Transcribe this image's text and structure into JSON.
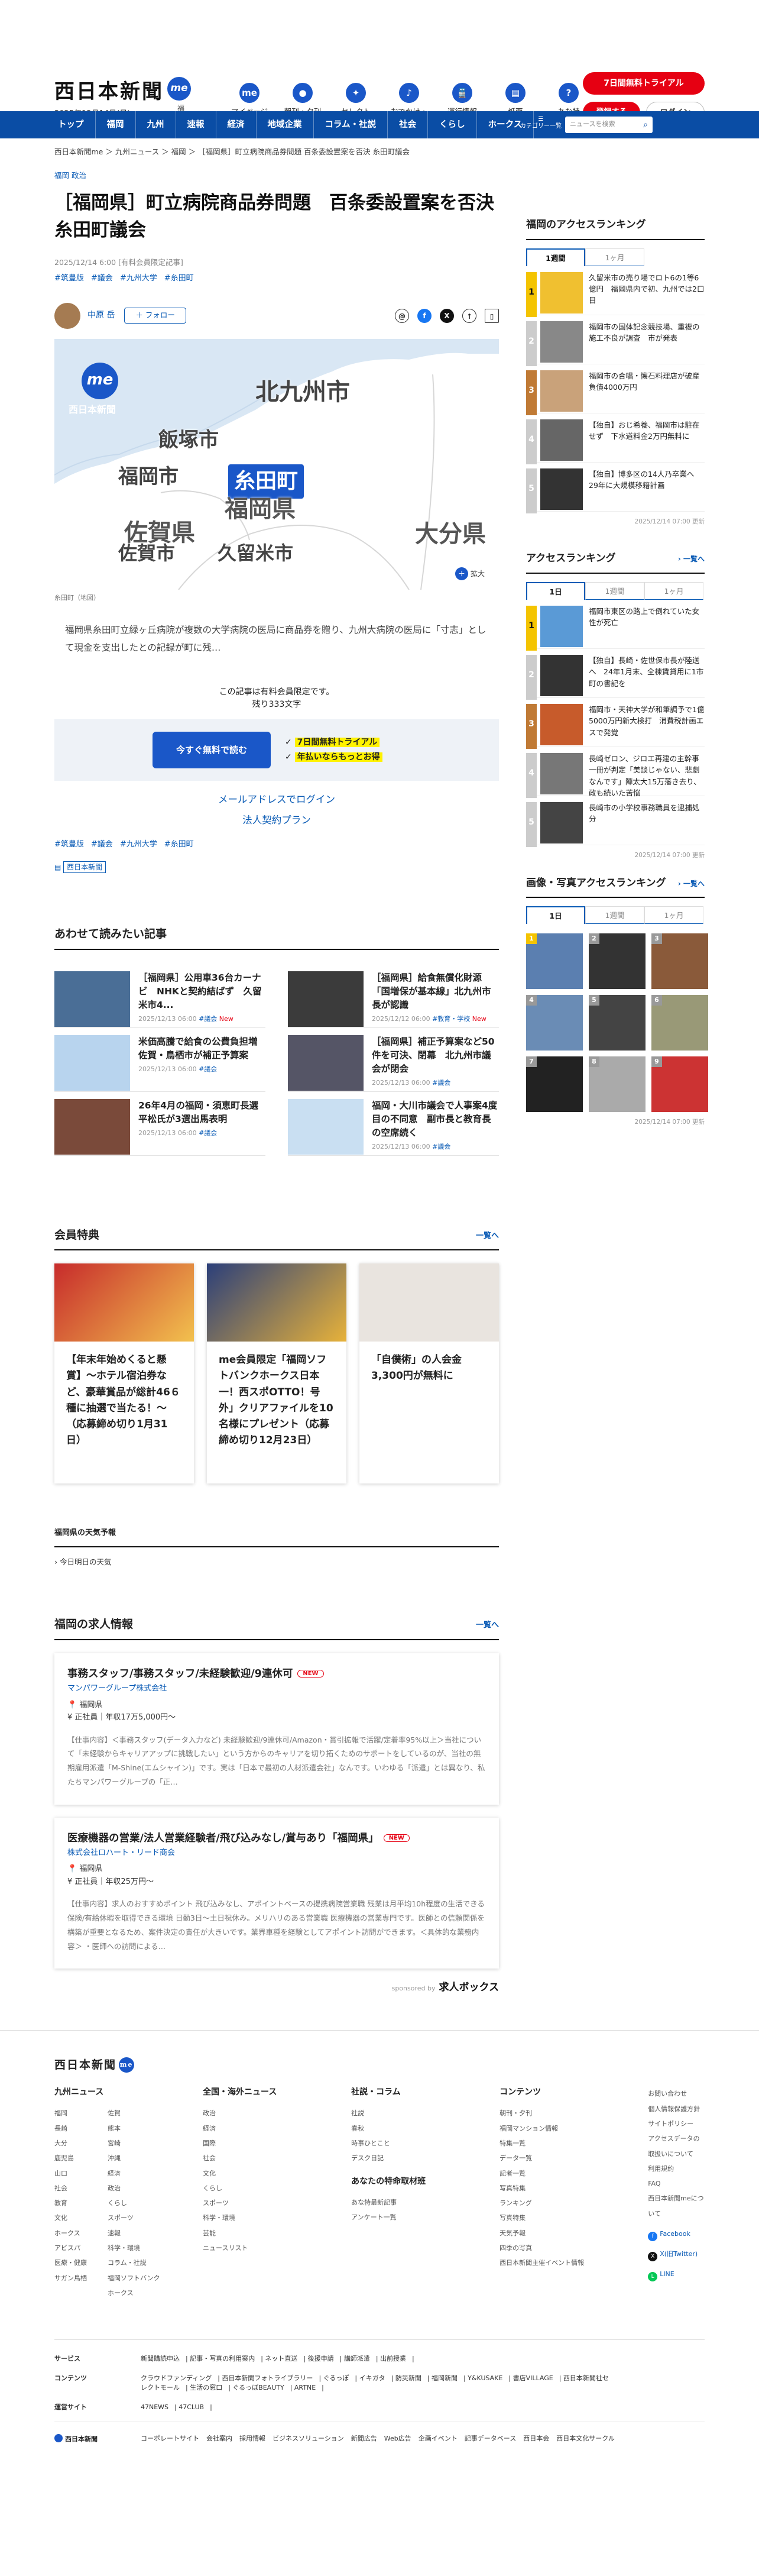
{
  "header": {
    "logo": "西日本新聞",
    "logo_mark": "me",
    "date": "2025年12月14日(日)",
    "corner": "福岡",
    "icons": [
      {
        "label": "マイページ",
        "icon": "me"
      },
      {
        "label": "朝刊・夕刊",
        "icon": "●"
      },
      {
        "label": "セレクト",
        "icon": "✦"
      },
      {
        "label": "おでかけ・特典",
        "icon": "♪"
      },
      {
        "label": "運行情報",
        "icon": "🚆"
      },
      {
        "label": "紙面",
        "icon": "▤"
      },
      {
        "label": "あな特",
        "icon": "?"
      }
    ],
    "trial": "7日間無料トライアル",
    "register": "登録する",
    "login": "ログイン"
  },
  "nav": {
    "items": [
      "トップ",
      "福岡",
      "九州",
      "速報",
      "経済",
      "地域企業",
      "コラム・社説",
      "社会",
      "くらし",
      "ホークス"
    ],
    "category": "カテゴリー一覧",
    "search_placeholder": "ニュースを検索"
  },
  "breadcrumb": "西日本新聞me ＞ 九州ニュース ＞ 福岡 ＞ ［福岡県］町立病院商品券問題 百条委設置案を否決 糸田町議会",
  "article": {
    "tags": "福岡 政治",
    "title": "［福岡県］町立病院商品券問題　百条委設置案を否決　糸田町議会",
    "date": "2025/12/14 6:00 [有料会員限定記事]",
    "keywords": [
      "#筑豊版",
      "#議会",
      "#九州大学",
      "#糸田町"
    ],
    "author": "中原 岳",
    "follow": "＋ フォロー",
    "map": {
      "labels": [
        "北九州市",
        "飯塚市",
        "福岡市",
        "糸田町",
        "福岡県",
        "佐賀県",
        "佐賀市",
        "久留米市",
        "大分県"
      ],
      "me": "me",
      "brand": "西日本新聞",
      "zoom": "拡大",
      "caption": "糸田町（地図）"
    },
    "lead": "福岡県糸田町立緑ヶ丘病院が複数の大学病院の医局に商品券を贈り、九州大病院の医局に「寸志」として現金を支出したとの記録が町に残…",
    "member_note": "この記事は有料会員限定です。",
    "remain": "残り333文字",
    "cta": "今すぐ無料で読む",
    "benefits": [
      "7日間無料トライアル",
      "年払いならもっとお得"
    ],
    "login_link": "メールアドレスでログイン",
    "plan_link": "法人契約プラン",
    "source": "西日本新聞"
  },
  "related": {
    "title": "あわせて読みたい記事",
    "items": [
      {
        "title": "［福岡県］公用車36台カーナビ　NHKと契約結ばず　久留米市4...",
        "meta": "2025/12/13 06:00",
        "tag": "議会",
        "new": "New"
      },
      {
        "title": "［福岡県］給食無償化財源「国増保が基本線」北九州市長が認識",
        "meta": "2025/12/12 06:00",
        "tag": "教育・学校",
        "new": "New"
      },
      {
        "title": "米価高騰で給食の公費負担増　佐賀・鳥栖市が補正予算案",
        "meta": "2025/12/13 06:00",
        "tag": "議会",
        "new": ""
      },
      {
        "title": "［福岡県］補正予算案など50件を可決、閉幕　北九州市議会が閉会",
        "meta": "2025/12/13 06:00",
        "tag": "議会",
        "new": ""
      },
      {
        "title": "26年4月の福岡・須恵町長選　平松氏が3選出馬表明",
        "meta": "2025/12/13 06:00",
        "tag": "議会",
        "new": ""
      },
      {
        "title": "福岡・大川市議会で人事案4度目の不同意　副市長と教育長の空席続く",
        "meta": "2025/12/13 06:00",
        "tag": "議会",
        "new": ""
      }
    ]
  },
  "perks": {
    "title": "会員特典",
    "more": "一覧へ",
    "items": [
      "【年末年始めくると懸賞】〜ホテル宿泊券など、豪華賞品が総計46６種に抽選で当たる！〜（応募締め切り1月31日）",
      "me会員限定「福岡ソフトバンクホークス日本一！西スポOTTO！号外」クリアファイルを10名様にプレゼント（応募締め切り12月23日）",
      "「自僕術」の人会金3,300円が無料に"
    ]
  },
  "weather": {
    "title": "福岡県の天気予報",
    "sub": "今日明日の天気"
  },
  "jobs": {
    "title": "福岡の求人情報",
    "more": "一覧へ",
    "items": [
      {
        "title": "事務スタッフ/事務スタッフ/未経験歓迎/9連休可",
        "new": "NEW",
        "company": "マンパワーグループ株式会社",
        "place": "福岡県",
        "pay": "正社員｜年収17万5,000円〜",
        "text": "【仕事内容】＜事務スタッフ(データ入力など) 未経験歓迎/9連休可/Amazon・賞引拡報で活躍/定着率95%以上＞当社について「未経験からキャリアアップに挑戦したい」という方からのキャリアを切り拓くためのサポートをしているのが、当社の無期雇用派遣「M-Shine(エムシャイン)」です。実は「日本で最初の人材派遣会社」なんです。いわゆる「派遣」とは異なり、私たちマンパワーグループの「正…"
      },
      {
        "title": "医療機器の営業/法人営業経験者/飛び込みなし/賞与あり「福岡県」",
        "new": "NEW",
        "company": "株式会社ロハート・リード商会",
        "place": "福岡県",
        "pay": "正社員｜年収25万円〜",
        "text": "【仕事内容】求人のおすすめポイント 飛び込みなし、アポイントベースの提携病院営業職 残業は月平均10h程度の生活できる保険/有給休暇を取得できる環境 日勤3日〜土日祝休み。メリハリのある営業職 医療機器の営業専門です。医師との信頼関係を構築が重要となるため、案件決定の責任が大きいです。業界車種を経験としてアポイント訪問ができます。＜具体的な業務内容＞ ・医師への訪問による…"
      }
    ],
    "sponsor": "sponsored by",
    "sponsor_name": "求人ボックス"
  },
  "sidebar": {
    "access": {
      "title": "福岡のアクセスランキング",
      "tabs": [
        "1週間",
        "1ヶ月"
      ],
      "items": [
        "久留米市の売り場でロト6の1等6億円　福岡県内で初、九州では2口目",
        "福岡市の国体記念競技場、重複の施工不良が調査　市が発表",
        "福岡市の合唱・懐石料理店が破産　負債4000万円",
        "【独自】おじ希養、福岡市は駐在せず　下水道料金2万円無料に",
        "【独自】博多区の14人乃卒業へ　29年に大規模移籍計画"
      ],
      "updated": "2025/12/14 07:00 更新"
    },
    "all": {
      "title": "アクセスランキング",
      "more": "一覧へ",
      "tabs": [
        "1日",
        "1週間",
        "1ヶ月"
      ],
      "items": [
        "福岡市東区の路上で倒れていた女性が死亡",
        "【独自】長崎・佐世保市長が陸送へ　24年1月末、全棟賃貸用に1市町の書記を",
        "福岡市・天神大学が和筆調予で1億5000万円新大検打　消費税計画エスで発覚",
        "長崎ゼロン、ジロエ再建の主幹事一冊が判定「美談じゃない、悲劇なんです」陣太大15万藩き去り、政も続いた苦悩",
        "長崎市の小学校事務職員を逮捕処分"
      ],
      "updated": "2025/12/14 07:00 更新"
    },
    "photo": {
      "title": "画像・写真アクセスランキング",
      "more": "一覧へ",
      "tabs": [
        "1日",
        "1週間",
        "1ヶ月"
      ],
      "updated": "2025/12/14 07:00 更新"
    }
  },
  "footer": {
    "logo": "西日本新聞",
    "cols": [
      {
        "title": "九州ニュース",
        "links": [
          "福岡",
          "佐賀",
          "長崎",
          "熊本",
          "大分",
          "宮崎",
          "鹿児島",
          "沖縄",
          "山口",
          "経済",
          "社会",
          "政治",
          "教育",
          "くらし",
          "文化",
          "スポーツ",
          "ホークス",
          "速報",
          "アビスパ",
          "科学・環境",
          "医療・健康",
          "コラム・社説",
          "サガン鳥栖",
          "福岡ソフトバンクホークス"
        ]
      },
      {
        "title": "全国・海外ニュース",
        "links": [
          "政治",
          "経済",
          "国際",
          "社会",
          "文化",
          "くらし",
          "スポーツ",
          "科学・環境",
          "芸能",
          "ニュースリスト"
        ]
      },
      {
        "title": "社説・コラム",
        "links": [
          "社説",
          "春秋",
          "時事ひとこと",
          "デスク日記"
        ],
        "sub": "あなたの特命取材班",
        "sublinks": [
          "あな特最新記事",
          "アンケート一覧"
        ]
      },
      {
        "title": "コンテンツ",
        "links": [
          "朝刊・夕刊",
          "福岡マンション情報",
          "特集一覧",
          "データ一覧",
          "記者一覧",
          "写真特集",
          "ランキング",
          "写真特集",
          "天気予報",
          "四季の写真",
          "西日本新聞主催イベント情報"
        ]
      },
      {
        "title": "",
        "links": [
          "お問い合わせ",
          "個人情報保護方針",
          "サイトポリシー",
          "アクセスデータの取扱いについて",
          "利用規約",
          "FAQ",
          "西日本新聞meについて"
        ],
        "sns": [
          "Facebook",
          "X(旧Twitter)",
          "LINE"
        ]
      }
    ],
    "rows": [
      {
        "label": "サービス",
        "links": [
          "新聞購読申込",
          "記事・写真の利用案内",
          "ネット直送",
          "後援申請",
          "講師派遣",
          "出前授業"
        ]
      },
      {
        "label": "コンテンツ",
        "links": [
          "クラウドファンディング",
          "西日本新聞フォトライブラリー",
          "ぐるっぽ",
          "イキガタ",
          "防災新聞",
          "福岡新聞",
          "Y&KUSAKE",
          "書店VILLAGE",
          "西日本新聞社セレクトモール",
          "生活の窓口",
          "ぐるっぽBEAUTY",
          "ARTNE"
        ]
      },
      {
        "label": "運営サイト",
        "links": [
          "47NEWS",
          "47CLUB"
        ]
      }
    ],
    "bottom_logo": "西日本新聞",
    "bottom_links": [
      "コーポレートサイト",
      "会社案内",
      "採用情報",
      "ビジネスソリューション",
      "新聞広告",
      "Web広告",
      "企画イベント",
      "記事データベース",
      "西日本会",
      "西日本文化サークル"
    ]
  },
  "colors": {
    "brand": "#1a57c8",
    "nav": "#0a4da5",
    "accent": "#e60012"
  }
}
